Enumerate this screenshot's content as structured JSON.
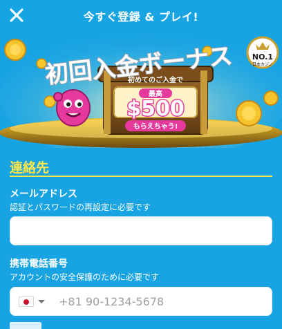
{
  "header": {
    "title": "今すぐ登録 & プレイ!",
    "close_icon": "close-icon"
  },
  "banner": {
    "headline": "初回入金ボーナス",
    "chest_caption": "初めてのご入金で",
    "max_label": "最高",
    "amount": "$500",
    "cta_text": "もらえちゃう!",
    "badge_top": "NO.1",
    "badge_bottom": "日本カジノ",
    "colors": {
      "pink": "#e53a9b",
      "gold": "#f6c42c",
      "blue": "#18a4e3"
    }
  },
  "form": {
    "section_title": "連絡先",
    "email": {
      "label": "メールアドレス",
      "hint": "認証とパスワードの再設定に必要です",
      "value": "",
      "placeholder": ""
    },
    "phone": {
      "label": "携帯電話番号",
      "hint": "アカウントの安全保護のために必要です",
      "country_icon": "japan-flag-icon",
      "placeholder": "+81 90-1234-5678",
      "value": ""
    }
  },
  "colors": {
    "background": "#18a4e3",
    "accent_yellow": "#ffe74a",
    "text": "#ffffff"
  }
}
